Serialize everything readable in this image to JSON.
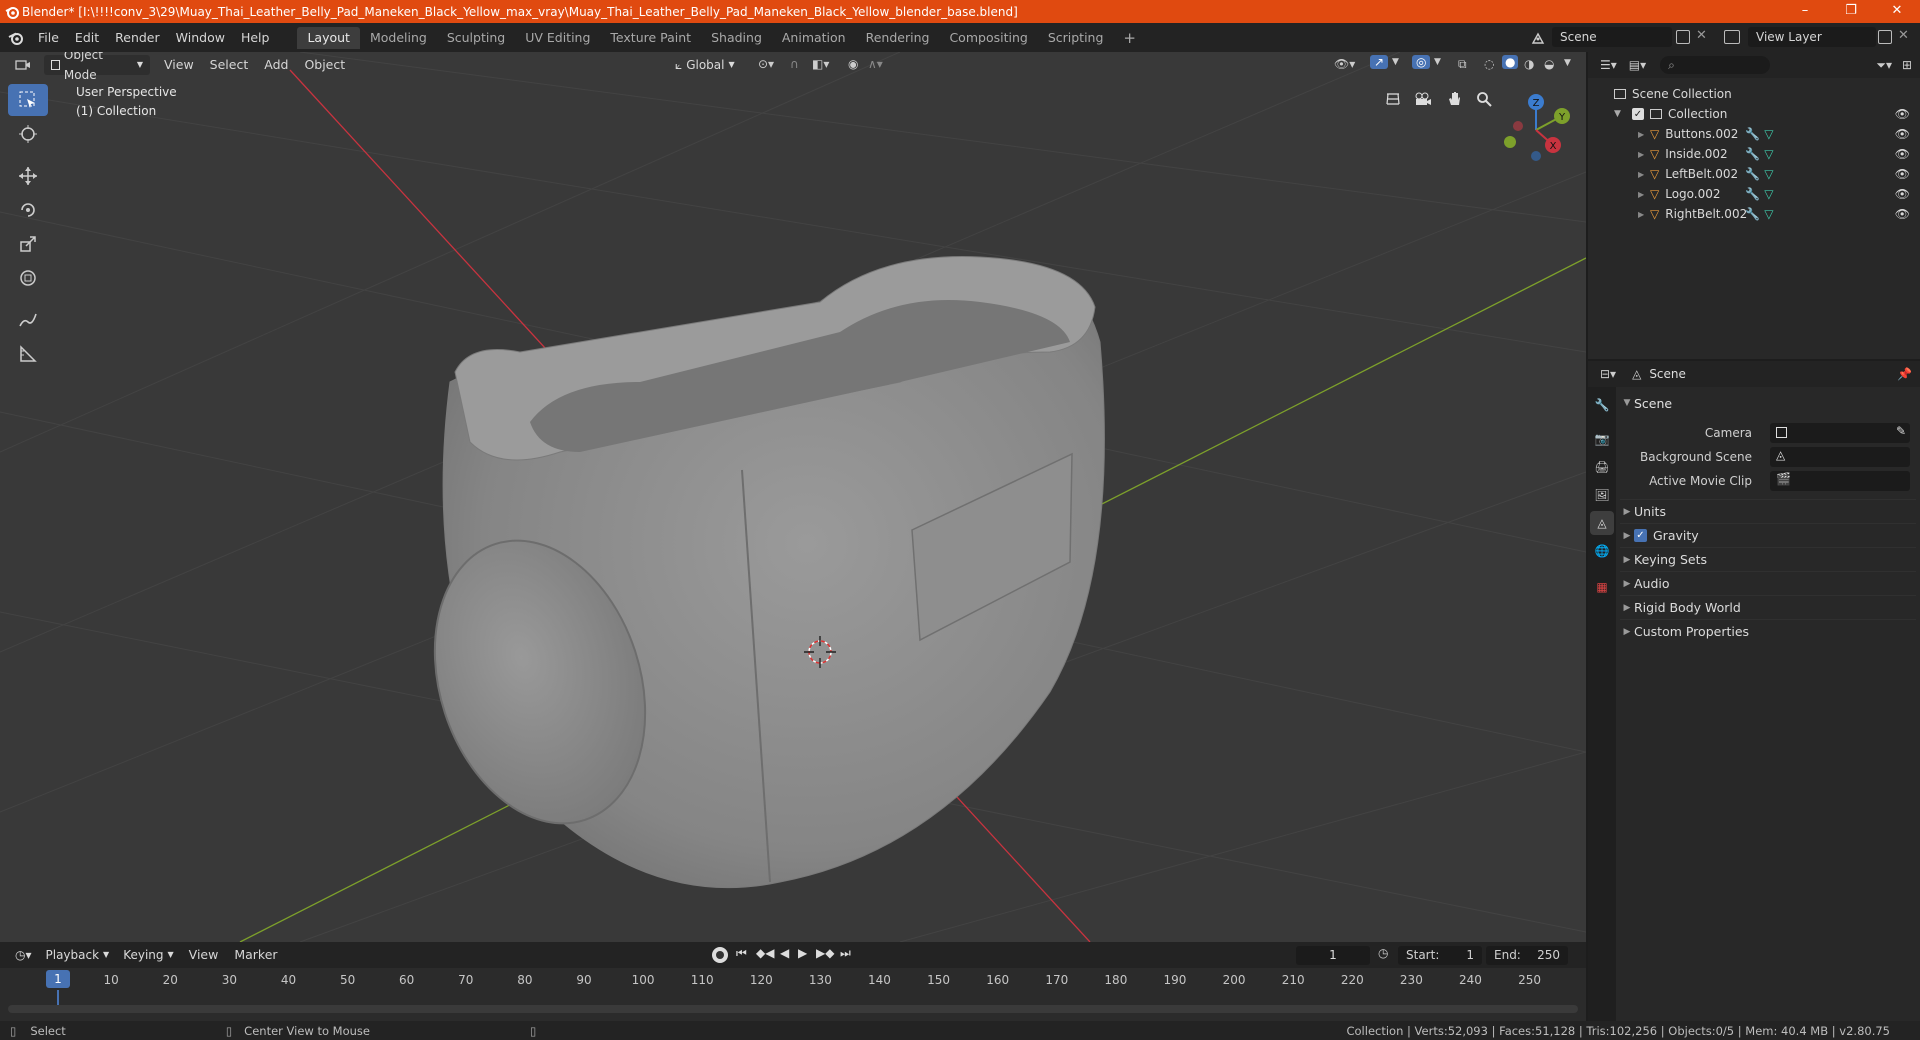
{
  "window": {
    "title": "Blender* [I:\\!!!!conv_3\\29\\Muay_Thai_Leather_Belly_Pad_Maneken_Black_Yellow_max_vray\\Muay_Thai_Leather_Belly_Pad_Maneken_Black_Yellow_blender_base.blend]",
    "controls": [
      "–",
      "❐",
      "✕"
    ]
  },
  "menu": [
    "File",
    "Edit",
    "Render",
    "Window",
    "Help"
  ],
  "workspaces": [
    "Layout",
    "Modeling",
    "Sculpting",
    "UV Editing",
    "Texture Paint",
    "Shading",
    "Animation",
    "Rendering",
    "Compositing",
    "Scripting"
  ],
  "active_workspace": "Layout",
  "add_workspace": "+",
  "scene_name": "Scene",
  "view_layer": "View Layer",
  "viewport": {
    "mode": "Object Mode",
    "menus": [
      "View",
      "Select",
      "Add",
      "Object"
    ],
    "orientation": "Global",
    "overlay_line1": "User Perspective",
    "overlay_line2": "(1) Collection",
    "gizmo": {
      "x": "X",
      "y": "Y",
      "z": "Z"
    }
  },
  "timeline": {
    "menus": [
      "Playback",
      "Keying",
      "View",
      "Marker"
    ],
    "current_frame": "1",
    "start_label": "Start:",
    "start": "1",
    "end_label": "End:",
    "end": "250",
    "ticks": [
      "10",
      "20",
      "30",
      "40",
      "50",
      "60",
      "70",
      "80",
      "90",
      "100",
      "110",
      "120",
      "130",
      "140",
      "150",
      "160",
      "170",
      "180",
      "190",
      "200",
      "210",
      "220",
      "230",
      "240",
      "250"
    ]
  },
  "status": {
    "left_action": "Select",
    "middle_action": "Center View to Mouse",
    "stats": "Collection | Verts:52,093 | Faces:51,128 | Tris:102,256 | Objects:0/5 | Mem: 40.4 MB | v2.80.75"
  },
  "outliner": {
    "root": "Scene Collection",
    "collection": "Collection",
    "objects": [
      "Buttons.002",
      "Inside.002",
      "LeftBelt.002",
      "Logo.002",
      "RightBelt.002"
    ]
  },
  "properties": {
    "context": "Scene",
    "panel_title": "Scene",
    "fields": [
      {
        "label": "Camera"
      },
      {
        "label": "Background Scene"
      },
      {
        "label": "Active Movie Clip"
      }
    ],
    "subpanels": [
      "Units",
      "Gravity",
      "Keying Sets",
      "Audio",
      "Rigid Body World",
      "Custom Properties"
    ],
    "gravity_checked": true
  },
  "colors": {
    "titlebar": "#e04a10",
    "accent": "#4772b3",
    "viewport_bg": "#393939",
    "x_axis": "#c8333f",
    "y_axis": "#7da02b",
    "z_axis": "#3b7ccf",
    "object_icon": "#e89a3c",
    "mesh_icon": "#3fc8a8"
  }
}
